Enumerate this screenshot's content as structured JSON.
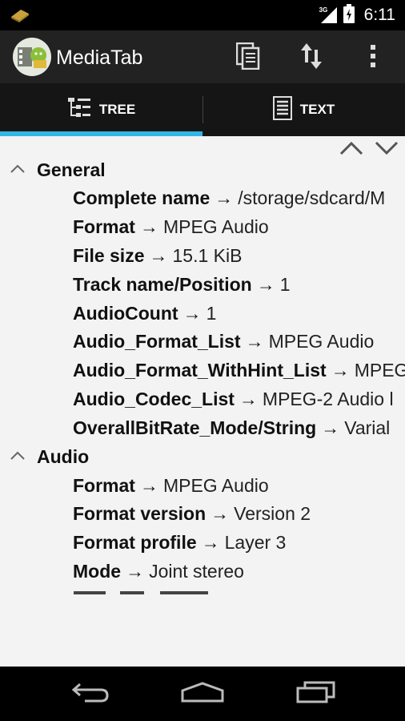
{
  "status_bar": {
    "network": "3G",
    "time": "6:11"
  },
  "action_bar": {
    "title": "MediaTab"
  },
  "tabs": [
    {
      "label": "TREE",
      "selected": true
    },
    {
      "label": "TEXT",
      "selected": false
    }
  ],
  "tree": {
    "sections": [
      {
        "title": "General",
        "rows": [
          {
            "key": "Complete name",
            "value": "/storage/sdcard/M"
          },
          {
            "key": "Format",
            "value": "MPEG Audio"
          },
          {
            "key": "File size",
            "value": "15.1 KiB"
          },
          {
            "key": "Track name/Position",
            "value": "1"
          },
          {
            "key": "AudioCount",
            "value": "1"
          },
          {
            "key": "Audio_Format_List",
            "value": "MPEG Audio"
          },
          {
            "key": "Audio_Format_WithHint_List",
            "value": "MPEG"
          },
          {
            "key": "Audio_Codec_List",
            "value": "MPEG-2 Audio l"
          },
          {
            "key": "OverallBitRate_Mode/String",
            "value": "Varial"
          }
        ]
      },
      {
        "title": "Audio",
        "rows": [
          {
            "key": "Format",
            "value": "MPEG Audio"
          },
          {
            "key": "Format version",
            "value": "Version 2"
          },
          {
            "key": "Format profile",
            "value": "Layer 3"
          },
          {
            "key": "Mode",
            "value": "Joint stereo"
          }
        ]
      }
    ],
    "arrow_symbol": "→"
  },
  "colors": {
    "accent": "#33b5e5",
    "action_bar": "#222222",
    "tab_bar": "#151515",
    "content_bg": "#f3f3f3"
  }
}
